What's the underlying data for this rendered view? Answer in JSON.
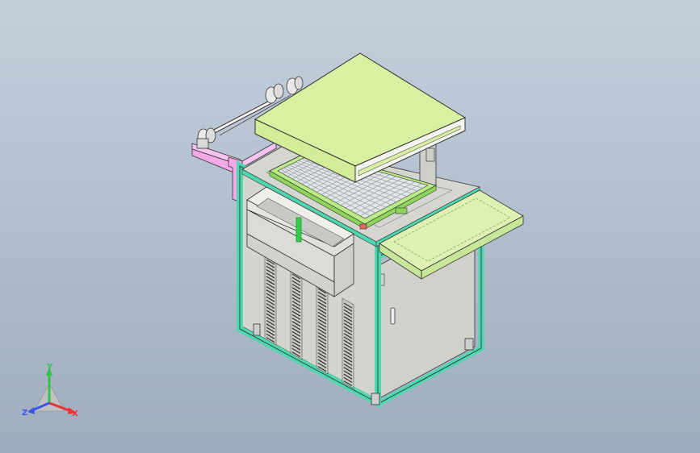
{
  "viewport": {
    "background_top": "#c4cfdb",
    "background_bottom": "#9eadbd"
  },
  "colors": {
    "lid": "#d9f0a3",
    "frame_outline": "#4fd7b0",
    "cabinet_panel": "#d5d5cf",
    "tray": "#ddf2b2",
    "bracket": "#f2a9e6",
    "grid_frame": "#b9ec84",
    "grid_mesh": "#9aa6ac"
  },
  "triad": {
    "x_label": "X",
    "y_label": "Y",
    "z_label": "Z",
    "x_color": "#e83232",
    "y_color": "#34c24a",
    "z_color": "#3a56e8"
  }
}
